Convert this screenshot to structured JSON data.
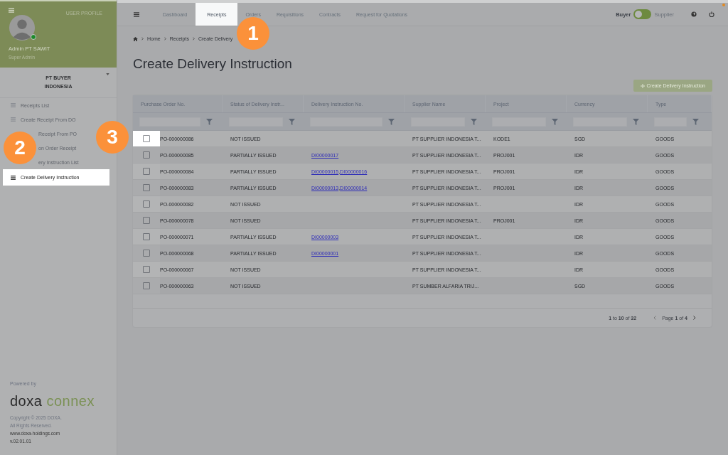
{
  "sidebar": {
    "profile_menu": "USER PROFILE",
    "user_name": "Admin PT SAWIT",
    "user_role": "Super Admin",
    "online": true,
    "company": "PT BUYER INDONESIA",
    "items": [
      {
        "label": "Receipts List",
        "selected": false
      },
      {
        "label": "Create Receipt From DO",
        "selected": false
      },
      {
        "label": "Receipt From PO",
        "selected": false,
        "covered": true
      },
      {
        "label": "on Order Receipt",
        "selected": false,
        "covered": true
      },
      {
        "label": "ery Instruction List",
        "selected": false,
        "covered": true
      },
      {
        "label": "Create Delivery Instruction",
        "selected": true
      }
    ],
    "powered_by": "Powered by",
    "logo_left": "doxa",
    "logo_right": "connex",
    "copyright": "Copyright © 2025 DOXA.",
    "rights": "All Rights Reserved.",
    "website": "www.doxa-holdings.com",
    "version": "v.02.01.01"
  },
  "nav": {
    "tabs": [
      {
        "label": "Dashboard",
        "selected": false
      },
      {
        "label": "Receipts",
        "selected": true
      },
      {
        "label": "Orders",
        "selected": false
      },
      {
        "label": "Requisitions",
        "selected": false
      },
      {
        "label": "Contracts",
        "selected": false
      },
      {
        "label": "Request for Quotations",
        "selected": false
      }
    ],
    "role_left": "Buyer",
    "role_right": "Supplier",
    "supplier_selected": false,
    "notification": true
  },
  "breadcrumb": [
    "Home",
    "Receipts",
    "Create Delivery"
  ],
  "page_title": "Create Delivery Instruction",
  "create_button": {
    "label": "Create Delivery Instruction",
    "disabled": true
  },
  "table": {
    "columns": [
      "Purchase Order No.",
      "Status of Delivery Instr...",
      "Delivery Instruction No.",
      "Supplier Name",
      "Project",
      "Currency",
      "Type"
    ],
    "rows": [
      {
        "po": "PO-000000086",
        "status": "NOT ISSUED",
        "di": [],
        "supplier": "PT SUPPLIER INDONESIA T...",
        "project": "KODE1",
        "currency": "SGD",
        "type": "GOODS",
        "checked": false,
        "highlight": true
      },
      {
        "po": "PO-000000085",
        "status": "PARTIALLY ISSUED",
        "di": [
          "DI00000017"
        ],
        "supplier": "PT SUPPLIER INDONESIA T...",
        "project": "PROJ001",
        "currency": "IDR",
        "type": "GOODS",
        "checked": false,
        "highlight": false
      },
      {
        "po": "PO-000000084",
        "status": "PARTIALLY ISSUED",
        "di": [
          "DI00000015",
          "DI00000016"
        ],
        "supplier": "PT SUPPLIER INDONESIA T...",
        "project": "PROJ001",
        "currency": "IDR",
        "type": "GOODS",
        "checked": false,
        "highlight": false
      },
      {
        "po": "PO-000000083",
        "status": "PARTIALLY ISSUED",
        "di": [
          "DI00000013",
          "DI00000014"
        ],
        "supplier": "PT SUPPLIER INDONESIA T...",
        "project": "PROJ001",
        "currency": "IDR",
        "type": "GOODS",
        "checked": false,
        "highlight": false
      },
      {
        "po": "PO-000000082",
        "status": "NOT ISSUED",
        "di": [],
        "supplier": "PT SUPPLIER INDONESIA T...",
        "project": "",
        "currency": "IDR",
        "type": "GOODS",
        "checked": false,
        "highlight": false
      },
      {
        "po": "PO-000000078",
        "status": "NOT ISSUED",
        "di": [],
        "supplier": "PT SUPPLIER INDONESIA T...",
        "project": "PROJ001",
        "currency": "IDR",
        "type": "GOODS",
        "checked": false,
        "highlight": false
      },
      {
        "po": "PO-000000071",
        "status": "PARTIALLY ISSUED",
        "di": [
          "DI00000003"
        ],
        "supplier": "PT SUPPLIER INDONESIA T...",
        "project": "",
        "currency": "IDR",
        "type": "GOODS",
        "checked": false,
        "highlight": false
      },
      {
        "po": "PO-000000068",
        "status": "PARTIALLY ISSUED",
        "di": [
          "DI00000001"
        ],
        "supplier": "PT SUPPLIER INDONESIA T...",
        "project": "",
        "currency": "IDR",
        "type": "GOODS",
        "checked": false,
        "highlight": false
      },
      {
        "po": "PO-000000067",
        "status": "NOT ISSUED",
        "di": [],
        "supplier": "PT SUPPLIER INDONESIA T...",
        "project": "",
        "currency": "IDR",
        "type": "GOODS",
        "checked": false,
        "highlight": false
      },
      {
        "po": "PO-000000063",
        "status": "NOT ISSUED",
        "di": [],
        "supplier": "PT SUMBER ALFARIA TRIJ...",
        "project": "",
        "currency": "SGD",
        "type": "GOODS",
        "checked": false,
        "highlight": false
      }
    ],
    "di_separator": ",",
    "range": "**1** to **10** of **32**",
    "page": "Page **1** of **4**"
  },
  "steps": [
    "1",
    "2",
    "3"
  ]
}
